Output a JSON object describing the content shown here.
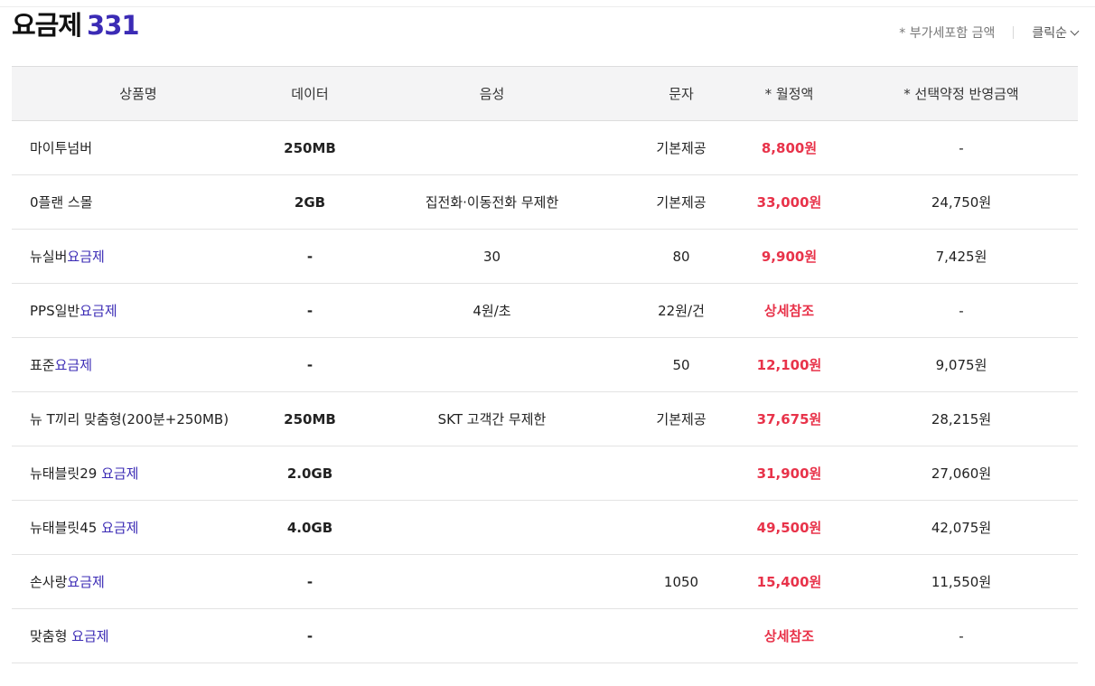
{
  "header": {
    "title": "요금제",
    "count": "331",
    "vat_note": "* 부가세포함 금액",
    "sort_label": "클릭순"
  },
  "columns": [
    "상품명",
    "데이터",
    "음성",
    "문자",
    "* 월정액",
    "* 선택약정 반영금액"
  ],
  "rows": [
    {
      "name": "마이투넘버",
      "suffix": "",
      "data": "250MB",
      "voice": "",
      "sms": "기본제공",
      "price": "8,800원",
      "discount": "-"
    },
    {
      "name": "0플랜 스몰",
      "suffix": "",
      "data": "2GB",
      "voice": "집전화·이동전화 무제한",
      "sms": "기본제공",
      "price": "33,000원",
      "discount": "24,750원"
    },
    {
      "name": "뉴실버",
      "suffix": "요금제",
      "data": "-",
      "voice": "30",
      "sms": "80",
      "price": "9,900원",
      "discount": "7,425원"
    },
    {
      "name": "PPS일반",
      "suffix": "요금제",
      "data": "-",
      "voice": "4원/초",
      "sms": "22원/건",
      "price": "상세참조",
      "discount": "-"
    },
    {
      "name": "표준",
      "suffix": "요금제",
      "data": "-",
      "voice": "",
      "sms": "50",
      "price": "12,100원",
      "discount": "9,075원"
    },
    {
      "name": "뉴 T끼리 맞춤형(200분+250MB)",
      "suffix": "",
      "data": "250MB",
      "voice": "SKT 고객간 무제한",
      "sms": "기본제공",
      "price": "37,675원",
      "discount": "28,215원"
    },
    {
      "name": "뉴태블릿29 ",
      "suffix": "요금제",
      "data": "2.0GB",
      "voice": "",
      "sms": "",
      "price": "31,900원",
      "discount": "27,060원"
    },
    {
      "name": "뉴태블릿45 ",
      "suffix": "요금제",
      "data": "4.0GB",
      "voice": "",
      "sms": "",
      "price": "49,500원",
      "discount": "42,075원"
    },
    {
      "name": "손사랑",
      "suffix": "요금제",
      "data": "-",
      "voice": "",
      "sms": "1050",
      "price": "15,400원",
      "discount": "11,550원"
    },
    {
      "name": "맞춤형 ",
      "suffix": "요금제",
      "data": "-",
      "voice": "",
      "sms": "",
      "price": "상세참조",
      "discount": "-"
    }
  ],
  "colors": {
    "accent": "#3b2bb5",
    "price": "#e8334a",
    "header_bg": "#f4f4f5"
  }
}
